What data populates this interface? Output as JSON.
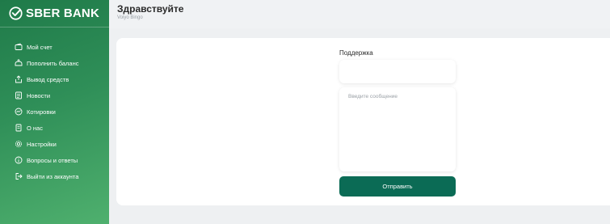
{
  "app": {
    "brand_name": "SBER BANK",
    "brand_color": "#21a038"
  },
  "sidebar": {
    "items": [
      {
        "label": "Мой счет",
        "icon": "wallet-icon"
      },
      {
        "label": "Пополнить баланс",
        "icon": "deposit-icon"
      },
      {
        "label": "Вывод средств",
        "icon": "withdraw-icon"
      },
      {
        "label": "Новости",
        "icon": "news-icon"
      },
      {
        "label": "Котировки",
        "icon": "chart-icon"
      },
      {
        "label": "О нас",
        "icon": "document-icon"
      },
      {
        "label": "Настройки",
        "icon": "gear-icon"
      },
      {
        "label": "Вопросы и ответы",
        "icon": "info-icon"
      },
      {
        "label": "Выйти из аккаунта",
        "icon": "logout-icon"
      }
    ]
  },
  "header": {
    "greeting": "Здравствуйте",
    "username": "Voiyo Bingo"
  },
  "support": {
    "title": "Поддержка",
    "subject_value": "",
    "message_placeholder": "Введите сообщение",
    "send_label": "Отправить",
    "button_color": "#0b6b55"
  }
}
